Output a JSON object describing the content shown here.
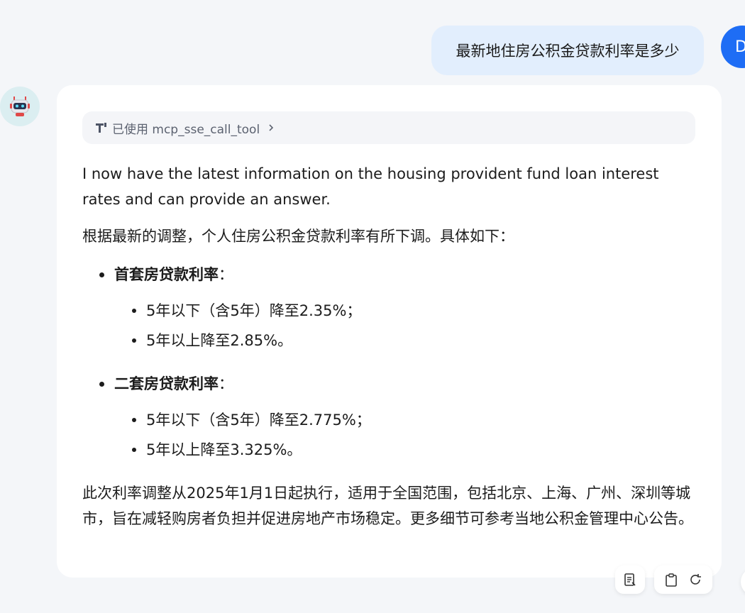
{
  "user_message": {
    "text": "最新地住房公积金贷款利率是多少",
    "avatar_initial": "D"
  },
  "tool_call": {
    "label": "已使用 mcp_sse_call_tool"
  },
  "answer": {
    "intro": "I now have the latest information on the housing provident fund loan interest rates and can provide an answer.",
    "summary": "根据最新的调整，个人住房公积金贷款利率有所下调。具体如下：",
    "sections": [
      {
        "title": "首套房贷款利率",
        "colon": "：",
        "items": [
          "5年以下（含5年）降至2.35%；",
          "5年以上降至2.85%。"
        ]
      },
      {
        "title": "二套房贷款利率",
        "colon": "：",
        "items": [
          "5年以下（含5年）降至2.775%；",
          "5年以上降至3.325%。"
        ]
      }
    ],
    "conclusion": "此次利率调整从2025年1月1日起执行，适用于全国范围，包括北京、上海、广州、深圳等城市，旨在减轻购房者负担并促进房地产市场稳定。更多细节可参考当地公积金管理中心公告。"
  },
  "colors": {
    "user_bubble": "#e2eefd",
    "user_avatar": "#1e6df5",
    "bot_avatar_bg": "#dbeef1",
    "page_bg": "#f4f6f9"
  },
  "icons": {
    "tool": "tool-icon",
    "chevron": "chevron-right-icon",
    "report": "report-icon",
    "copy": "clipboard-icon",
    "regenerate": "refresh-icon"
  }
}
